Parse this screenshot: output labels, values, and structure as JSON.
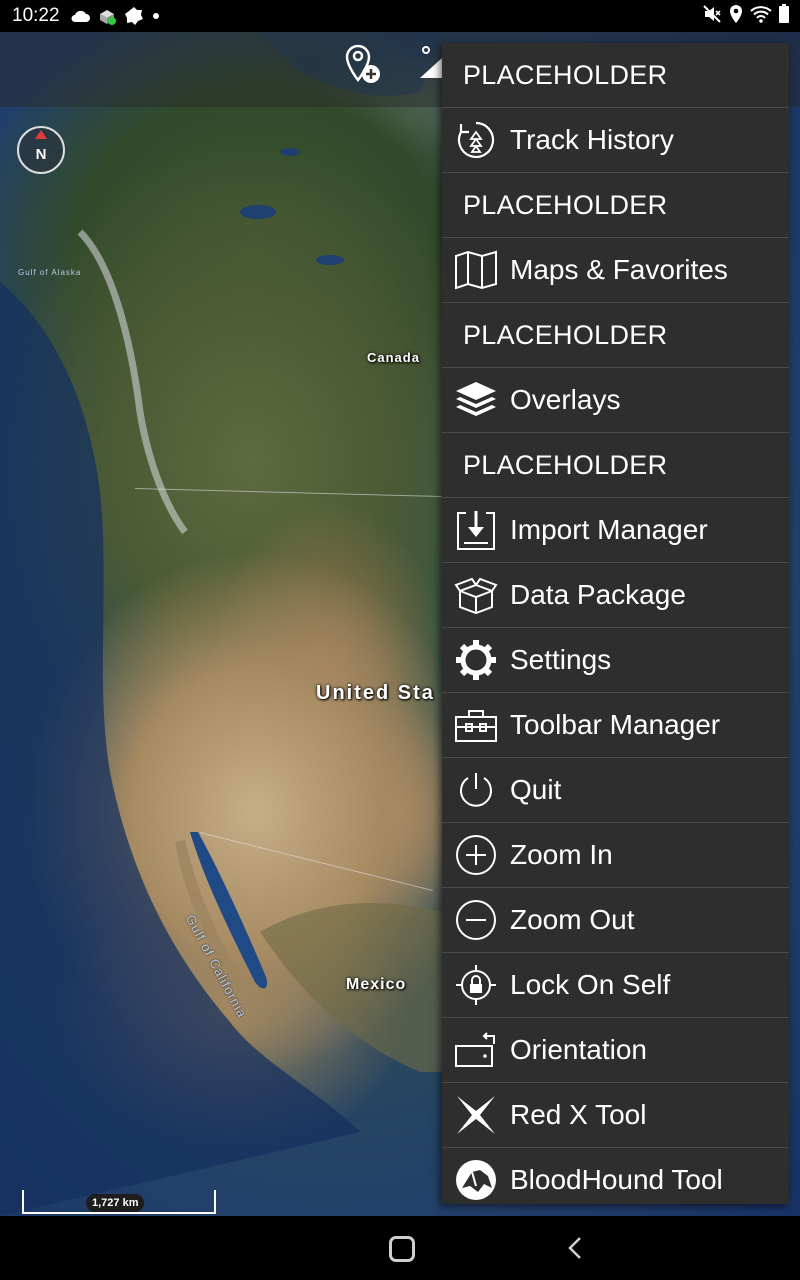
{
  "status_bar": {
    "time": "10:22",
    "left_icons": [
      "cloud-icon",
      "app-notification-icon",
      "gear-badge-icon",
      "dot-icon"
    ],
    "right_icons": [
      "mute-icon",
      "location-icon",
      "wifi-icon",
      "battery-icon"
    ]
  },
  "map": {
    "labels": {
      "canada": "Canada",
      "united_states": "United Sta",
      "mexico": "Mexico",
      "gulf_of_california": "Gulf of California",
      "gulf_of_alaska": "Gulf of Alaska"
    },
    "compass_label": "N",
    "scale_text": "1,727 km"
  },
  "menu": {
    "items": [
      {
        "type": "header",
        "label": "PLACEHOLDER"
      },
      {
        "type": "item",
        "label": "Track History",
        "icon": "track-history-icon"
      },
      {
        "type": "header",
        "label": "PLACEHOLDER"
      },
      {
        "type": "item",
        "label": "Maps & Favorites",
        "icon": "map-icon"
      },
      {
        "type": "header",
        "label": "PLACEHOLDER"
      },
      {
        "type": "item",
        "label": "Overlays",
        "icon": "layers-icon"
      },
      {
        "type": "header",
        "label": "PLACEHOLDER"
      },
      {
        "type": "item",
        "label": "Import Manager",
        "icon": "import-icon"
      },
      {
        "type": "item",
        "label": "Data Package",
        "icon": "package-icon"
      },
      {
        "type": "item",
        "label": "Settings",
        "icon": "gear-icon"
      },
      {
        "type": "item",
        "label": "Toolbar Manager",
        "icon": "toolbox-icon"
      },
      {
        "type": "item",
        "label": "Quit",
        "icon": "power-icon"
      },
      {
        "type": "item",
        "label": "Zoom In",
        "icon": "zoom-in-icon"
      },
      {
        "type": "item",
        "label": "Zoom Out",
        "icon": "zoom-out-icon"
      },
      {
        "type": "item",
        "label": "Lock On Self",
        "icon": "lock-on-self-icon"
      },
      {
        "type": "item",
        "label": "Orientation",
        "icon": "orientation-icon"
      },
      {
        "type": "item",
        "label": "Red X Tool",
        "icon": "x-tool-icon"
      },
      {
        "type": "item",
        "label": "BloodHound Tool",
        "icon": "bloodhound-icon"
      }
    ]
  },
  "nav_bar": {
    "buttons": [
      "home-button",
      "back-button"
    ]
  }
}
